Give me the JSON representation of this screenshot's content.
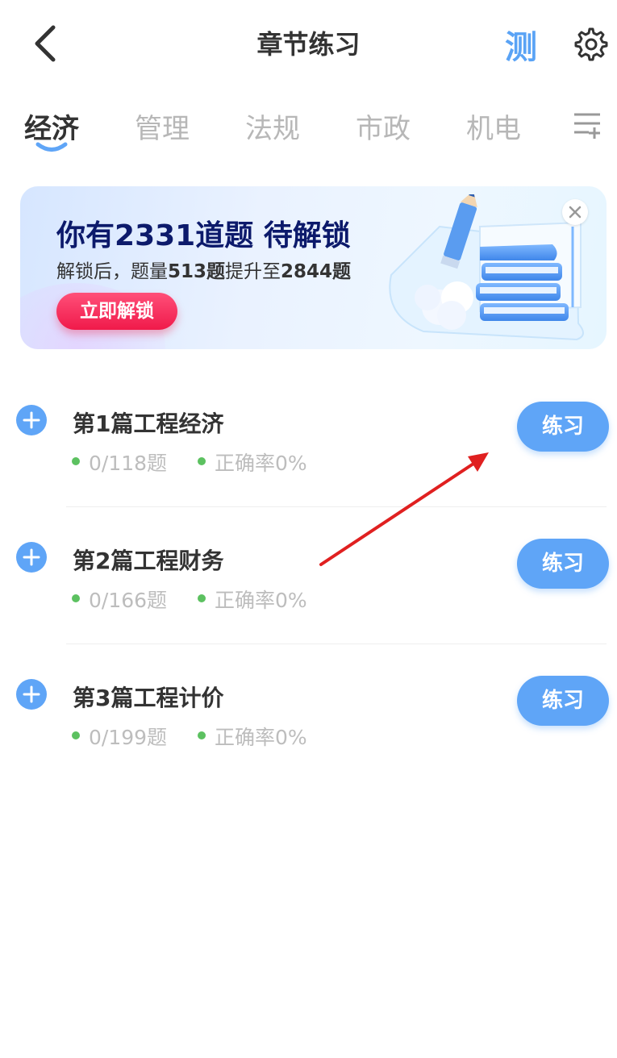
{
  "header": {
    "title": "章节练习",
    "test_label": "测"
  },
  "tabs": [
    {
      "label": "经济",
      "active": true
    },
    {
      "label": "管理",
      "active": false
    },
    {
      "label": "法规",
      "active": false
    },
    {
      "label": "市政",
      "active": false
    },
    {
      "label": "机电",
      "active": false
    }
  ],
  "banner": {
    "title_prefix": "你有",
    "title_count": "2331",
    "title_mid": "道题",
    "title_suffix": "待解锁",
    "sub_prefix": "解锁后，题量",
    "sub_from": "513题",
    "sub_mid": "提升至",
    "sub_to": "2844题",
    "button_label": "立即解锁"
  },
  "chapters": [
    {
      "title": "第1篇工程经济",
      "progress": "0/118题",
      "accuracy": "正确率0%",
      "button": "练习"
    },
    {
      "title": "第2篇工程财务",
      "progress": "0/166题",
      "accuracy": "正确率0%",
      "button": "练习"
    },
    {
      "title": "第3篇工程计价",
      "progress": "0/199题",
      "accuracy": "正确率0%",
      "button": "练习"
    }
  ],
  "colors": {
    "accent": "#5fa5f7",
    "banner_title": "#0c1a6b",
    "unlock_button": "#f01a4a",
    "dot_green": "#5cc160",
    "annotation_arrow": "#e02020"
  }
}
